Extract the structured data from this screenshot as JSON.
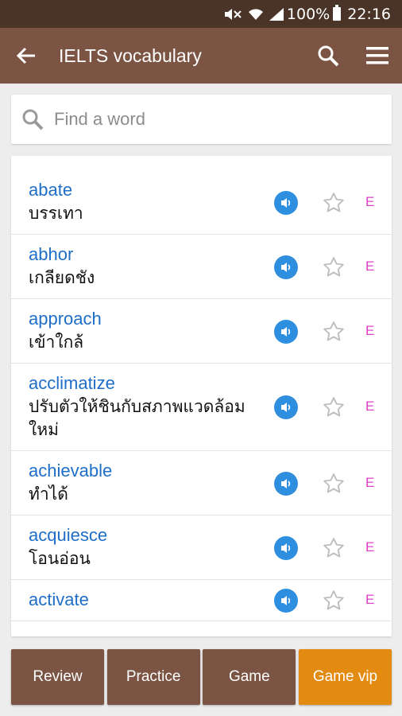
{
  "status_bar": {
    "battery": "100%",
    "time": "22:16"
  },
  "app_bar": {
    "title": "IELTS vocabulary"
  },
  "search": {
    "placeholder": "Find a word"
  },
  "words": [
    {
      "word": "abate",
      "meaning": "บรรเทา"
    },
    {
      "word": "abhor",
      "meaning": "เกลียดชัง"
    },
    {
      "word": "approach",
      "meaning": "เข้าใกล้"
    },
    {
      "word": "acclimatize",
      "meaning": "ปรับตัวให้ชินกับสภาพแวดล้อมใหม่"
    },
    {
      "word": "achievable",
      "meaning": "ทำได้"
    },
    {
      "word": "acquiesce",
      "meaning": "โอนอ่อน"
    },
    {
      "word": "activate",
      "meaning": ""
    }
  ],
  "row_extra_label": "E",
  "buttons": {
    "review": "Review",
    "practice": "Practice",
    "game": "Game",
    "game_vip": "Game vip"
  },
  "colors": {
    "status_bar": "#4a3427",
    "app_bar": "#7b5444",
    "word": "#1e6ec8",
    "speaker": "#2e8ee0",
    "edit": "#e040c8",
    "button": "#7b5444",
    "button_vip": "#e38a10"
  },
  "icons": [
    "back-arrow-icon",
    "search-icon",
    "menu-icon",
    "speaker-icon",
    "star-icon"
  ]
}
